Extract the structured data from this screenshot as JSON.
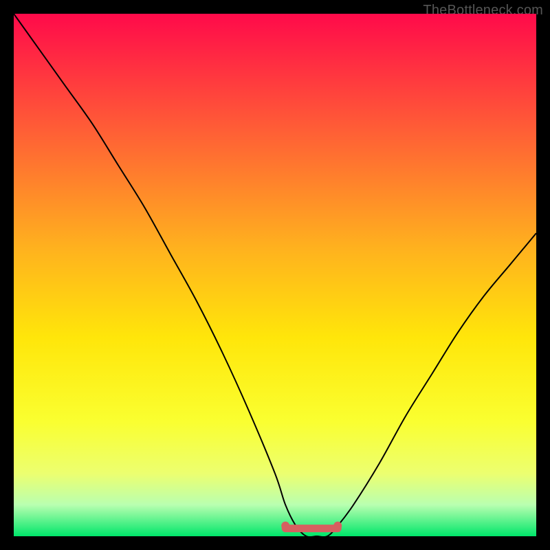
{
  "attribution": "TheBottleneck.com",
  "chart_data": {
    "type": "line",
    "title": "",
    "xlabel": "",
    "ylabel": "",
    "xlim": [
      0,
      100
    ],
    "ylim": [
      0,
      100
    ],
    "series": [
      {
        "name": "bottleneck-curve",
        "x": [
          0,
          5,
          10,
          15,
          20,
          25,
          30,
          35,
          40,
          45,
          50,
          52,
          54,
          56,
          58,
          60,
          62,
          65,
          70,
          75,
          80,
          85,
          90,
          95,
          100
        ],
        "y": [
          100,
          93,
          86,
          79,
          71,
          63,
          54,
          45,
          35,
          24,
          12,
          6,
          2,
          0,
          0,
          0,
          2,
          6,
          14,
          23,
          31,
          39,
          46,
          52,
          58
        ]
      }
    ],
    "recommended_band": {
      "x_start": 52,
      "x_end": 62,
      "y": 1.5
    },
    "gradient_stops": [
      {
        "pos": 0.0,
        "color": "#ff0a4a"
      },
      {
        "pos": 0.22,
        "color": "#ff5d36"
      },
      {
        "pos": 0.45,
        "color": "#ffb21e"
      },
      {
        "pos": 0.62,
        "color": "#ffe60a"
      },
      {
        "pos": 0.78,
        "color": "#faff30"
      },
      {
        "pos": 0.88,
        "color": "#ecff70"
      },
      {
        "pos": 0.94,
        "color": "#b9ffb0"
      },
      {
        "pos": 1.0,
        "color": "#00e66a"
      }
    ],
    "marker_color": "#d66060",
    "curve_color": "#000000"
  }
}
